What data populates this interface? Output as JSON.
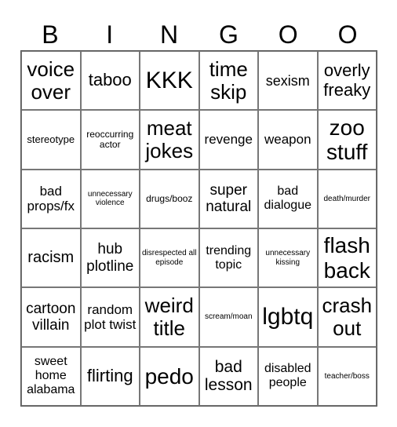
{
  "header": [
    "B",
    "I",
    "N",
    "G",
    "O",
    "O"
  ],
  "cells": [
    [
      "voice over",
      "taboo",
      "KKK",
      "time skip",
      "sexism",
      "overly freaky"
    ],
    [
      "stereotype",
      "reoccurring actor",
      "meat jokes",
      "revenge",
      "weapon",
      "zoo stuff"
    ],
    [
      "bad props/fx",
      "unnecessary violence",
      "drugs/booz",
      "super natural",
      "bad dialogue",
      "death/murder"
    ],
    [
      "racism",
      "hub plotline",
      "disrespected all episode",
      "trending topic",
      "unnecessary kissing",
      "flash back"
    ],
    [
      "cartoon villain",
      "random plot twist",
      "weird title",
      "scream/moan",
      "lgbtq",
      "crash out"
    ],
    [
      "sweet home alabama",
      "flirting",
      "pedo",
      "bad lesson",
      "disabled people",
      "teacher/boss"
    ]
  ]
}
